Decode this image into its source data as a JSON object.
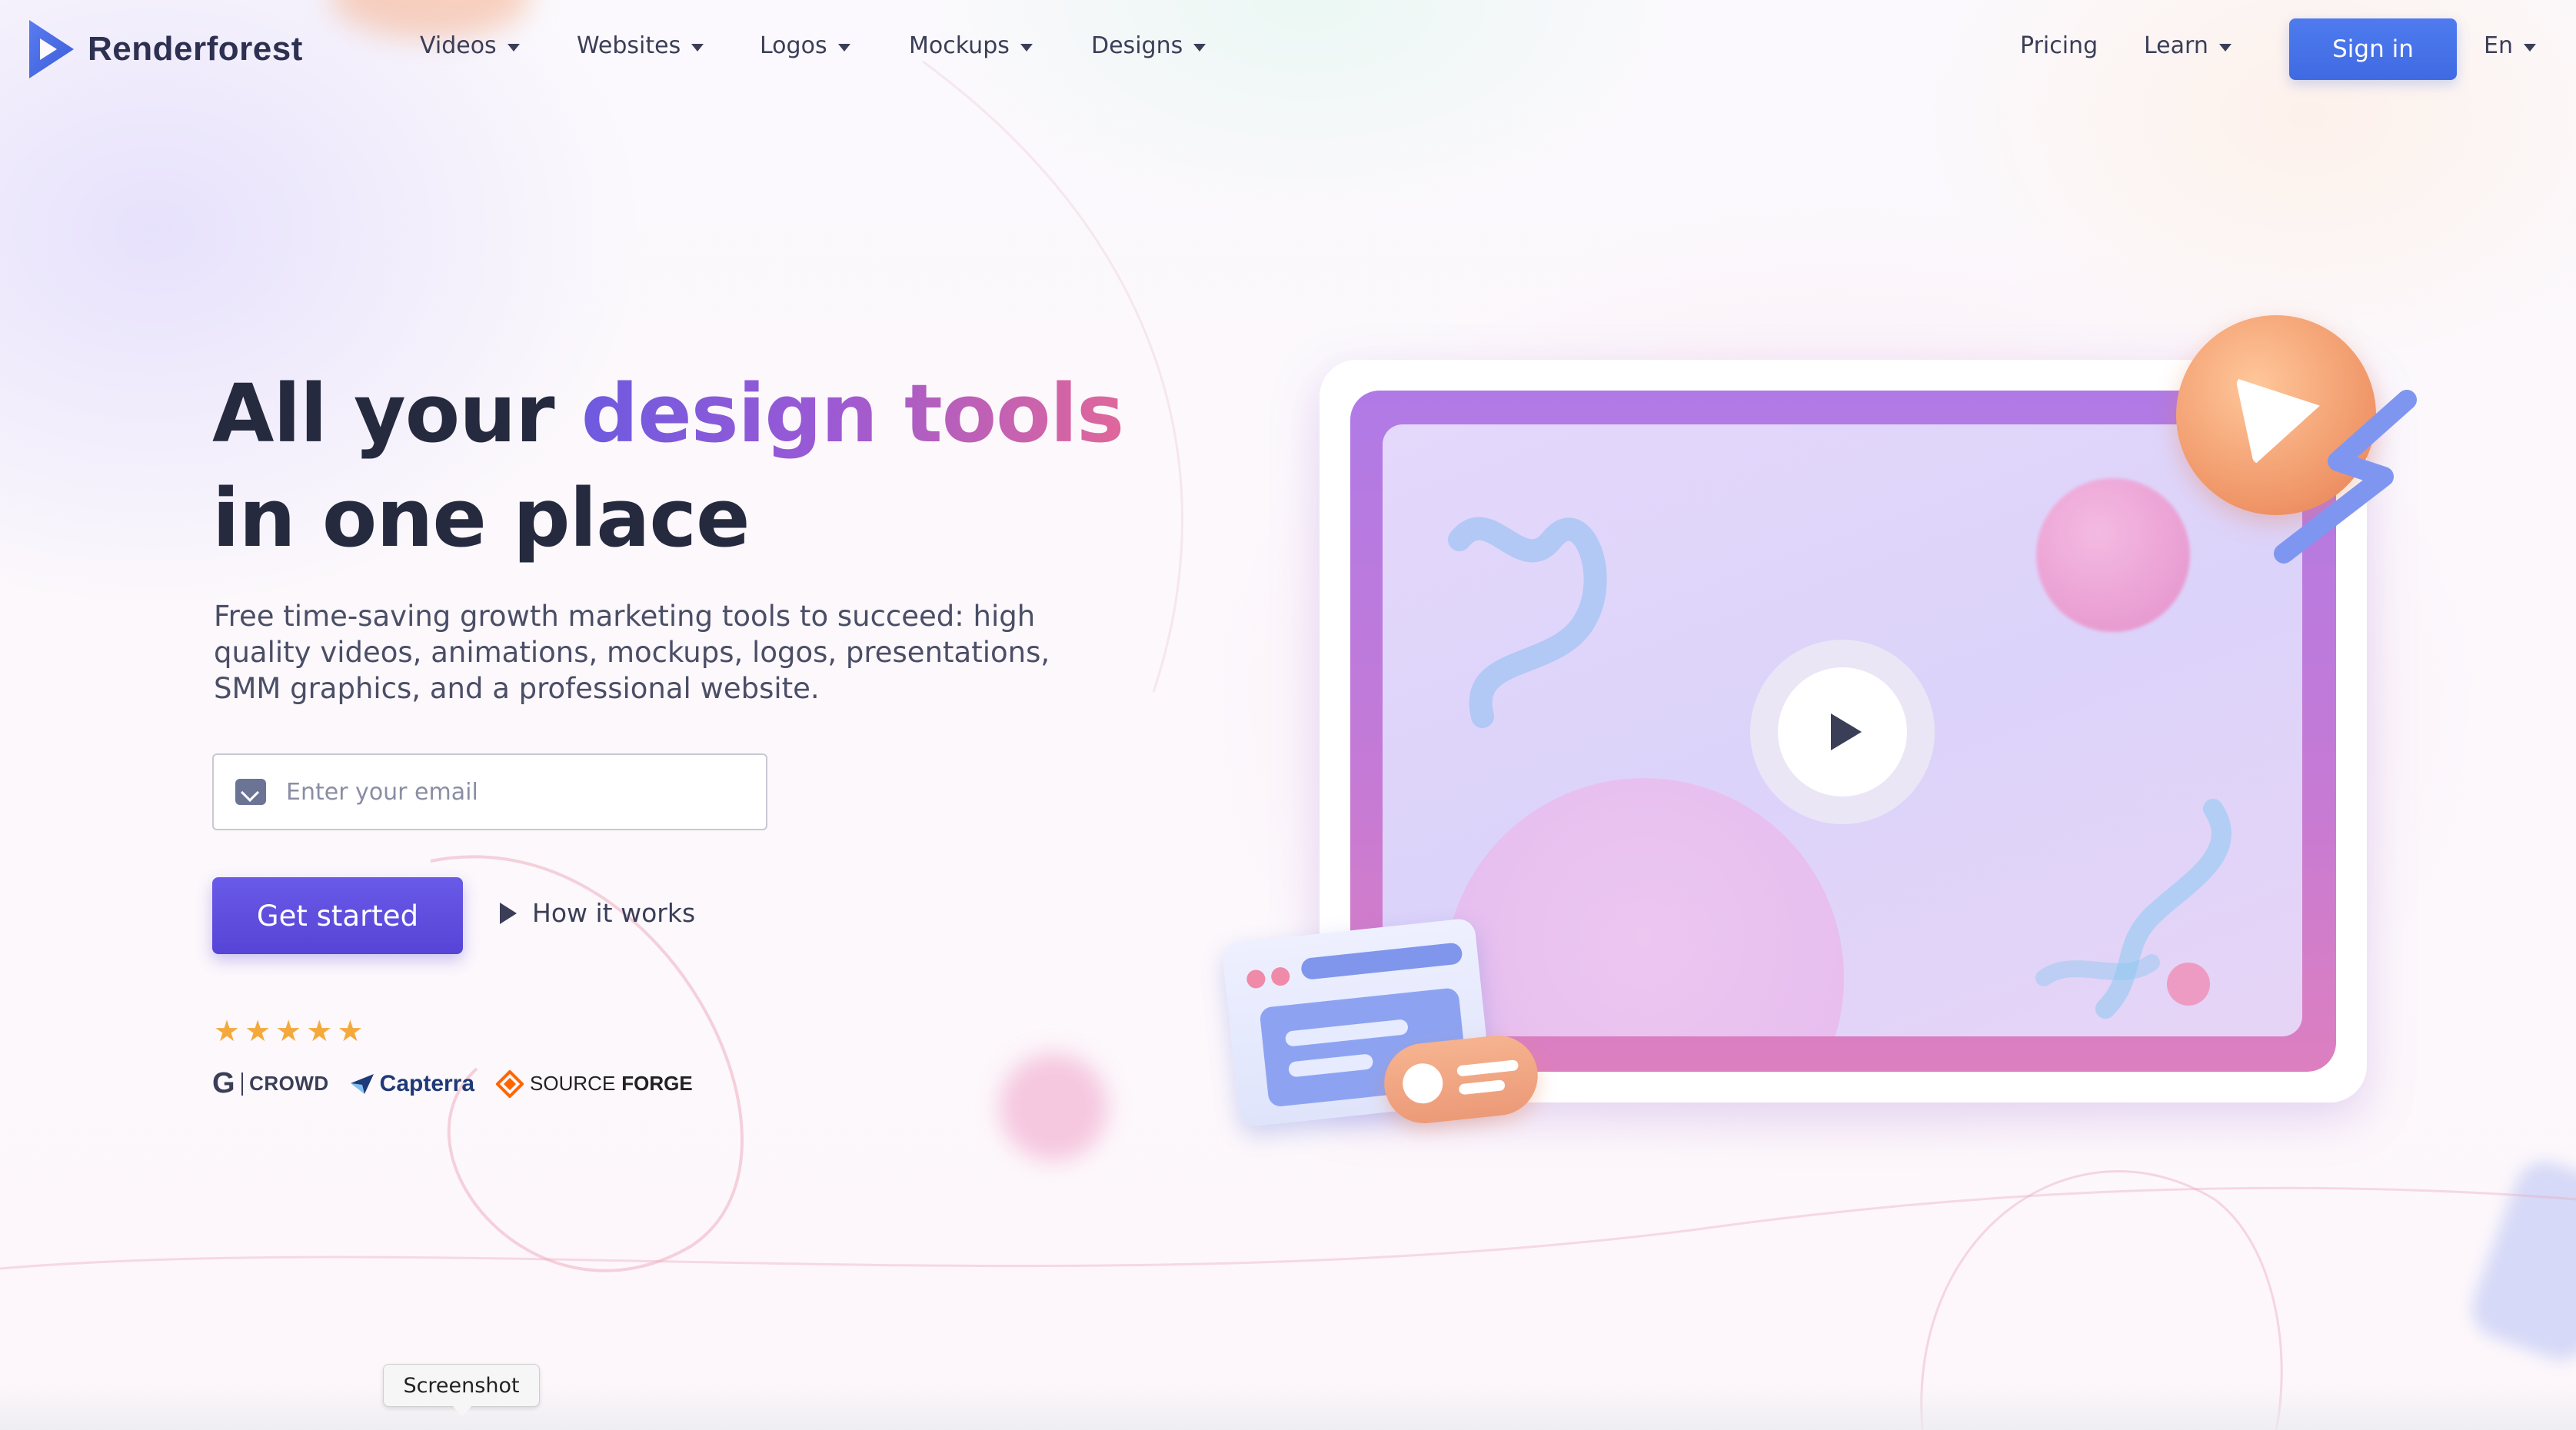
{
  "brand": {
    "name": "Renderforest",
    "logo_icon": "play-triangle-logo",
    "accent": "#4f7bef"
  },
  "nav": {
    "items": [
      {
        "label": "Videos",
        "has_dropdown": true
      },
      {
        "label": "Websites",
        "has_dropdown": true
      },
      {
        "label": "Logos",
        "has_dropdown": true
      },
      {
        "label": "Mockups",
        "has_dropdown": true
      },
      {
        "label": "Designs",
        "has_dropdown": true
      }
    ],
    "pricing": "Pricing",
    "learn": "Learn",
    "signin": "Sign in",
    "language": "En"
  },
  "hero": {
    "title_part1": "All your ",
    "title_highlight": "design tools",
    "title_part2": "in one place",
    "subtitle": "Free time-saving growth marketing tools to succeed: high quality videos, animations, mockups, logos, presentations, SMM graphics, and a professional website.",
    "email_placeholder": "Enter your email",
    "cta": "Get started",
    "how_it_works": "How it works",
    "rating_stars": 5,
    "review_sites": {
      "g2_label": "CROWD",
      "capterra": "Capterra",
      "sourceforge_a": "SOURCE",
      "sourceforge_b": "FORGE"
    }
  },
  "tooltip": {
    "label": "Screenshot"
  },
  "colors": {
    "cta": "#5644d6",
    "title": "#262a3f",
    "gradient_start": "#6e5ae0",
    "gradient_end": "#e0679a",
    "star": "#f4a93b"
  }
}
